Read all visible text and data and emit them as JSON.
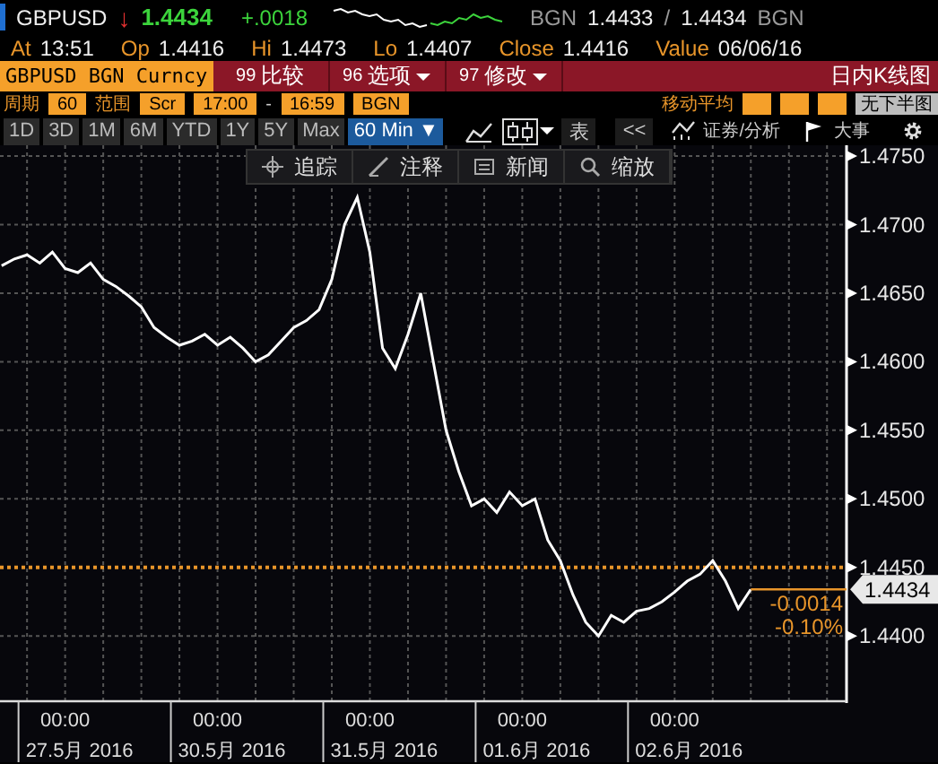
{
  "quote": {
    "ticker": "GBPUSD",
    "arrow": "↓",
    "last": "1.4434",
    "change": "+.0018",
    "bid_source": "BGN",
    "bid": "1.4433",
    "separator": "/",
    "ask": "1.4434",
    "ask_source": "BGN"
  },
  "stats": [
    {
      "label": "At",
      "value": "13:51"
    },
    {
      "label": "Op",
      "value": "1.4416"
    },
    {
      "label": "Hi",
      "value": "1.4473"
    },
    {
      "label": "Lo",
      "value": "1.4407"
    },
    {
      "label": "Close",
      "value": "1.4416"
    },
    {
      "label": "Value",
      "value": "06/06/16"
    }
  ],
  "command_bar": {
    "security": "GBPUSD BGN Curncy",
    "actions": [
      {
        "code": "99",
        "label": "比较",
        "dropdown": false
      },
      {
        "code": "96",
        "label": "选项",
        "dropdown": true
      },
      {
        "code": "97",
        "label": "修改",
        "dropdown": true
      }
    ],
    "view_title": "日内K线图"
  },
  "settings": {
    "period_label": "周期",
    "period": "60",
    "range_label": "范围",
    "range_fields": [
      {
        "kind": "field",
        "text": "Scr"
      },
      {
        "kind": "field",
        "text": "17:00"
      },
      {
        "kind": "text",
        "text": "-"
      },
      {
        "kind": "field",
        "text": "16:59"
      },
      {
        "kind": "field",
        "text": "BGN"
      }
    ],
    "moving_average_label": "移动平均",
    "lower_chart": "无下半图"
  },
  "toolbar": {
    "ranges": [
      {
        "label": "1D",
        "selected": false
      },
      {
        "label": "3D",
        "selected": false
      },
      {
        "label": "1M",
        "selected": false
      },
      {
        "label": "6M",
        "selected": false
      },
      {
        "label": "YTD",
        "selected": false
      },
      {
        "label": "1Y",
        "selected": false
      },
      {
        "label": "5Y",
        "selected": false
      },
      {
        "label": "Max",
        "selected": false
      },
      {
        "label": "60 Min ▼",
        "selected": true
      }
    ],
    "chart_types": [
      {
        "kind": "line",
        "selected": false
      },
      {
        "kind": "candle",
        "selected": true
      }
    ],
    "table_button": "表",
    "back_button": "<<",
    "analysis": "证券/分析",
    "events": "大事"
  },
  "chart_tools": [
    {
      "kind": "crosshair",
      "label": "追踪"
    },
    {
      "kind": "pencil",
      "label": "注释"
    },
    {
      "kind": "news",
      "label": "新闻"
    },
    {
      "kind": "search",
      "label": "缩放"
    }
  ],
  "chart": {
    "last_price_tag": "1.4434",
    "change": "-0.0014",
    "change_pct": "-0.10%",
    "dates": [
      "27.5月 2016",
      "30.5月 2016",
      "31.5月 2016",
      "01.6月 2016",
      "02.6月 2016"
    ],
    "chart_data": {
      "type": "line",
      "categories": [
        null,
        null,
        null,
        null,
        null,
        "00:00",
        null,
        null,
        null,
        null,
        null,
        null,
        null,
        null,
        null,
        null,
        null,
        "00:00",
        null,
        null,
        null,
        null,
        null,
        null,
        null,
        null,
        null,
        null,
        null,
        "00:00",
        null,
        null,
        null,
        null,
        null,
        null,
        null,
        null,
        null,
        null,
        null,
        "00:00",
        null,
        null,
        null,
        null,
        null,
        null,
        null,
        null,
        null,
        null,
        null,
        "00:00",
        null,
        null,
        null,
        null,
        null,
        null
      ],
      "series": [
        {
          "color": "#ffffff",
          "values": [
            1.467,
            1.4675,
            1.4678,
            1.4672,
            1.468,
            1.4668,
            1.4665,
            1.4672,
            1.466,
            1.4655,
            1.4648,
            1.464,
            1.4625,
            1.4618,
            1.4612,
            1.4615,
            1.462,
            1.4612,
            1.4618,
            1.461,
            1.46,
            1.4605,
            1.4615,
            1.4625,
            1.463,
            1.4638,
            1.466,
            1.47,
            1.472,
            1.468,
            1.461,
            1.4595,
            1.462,
            1.465,
            1.46,
            1.455,
            1.452,
            1.4495,
            1.45,
            1.449,
            1.4505,
            1.4495,
            1.45,
            1.447,
            1.4455,
            1.443,
            1.441,
            1.44,
            1.4415,
            1.441,
            1.4418,
            1.442,
            1.4425,
            1.4432,
            1.444,
            1.4445,
            1.4455,
            1.444,
            1.442,
            1.4434
          ]
        }
      ],
      "ylim": [
        1.43524,
        1.47579
      ],
      "grid": true,
      "yticks": [
        {
          "value": 1.475,
          "label": "1.4750"
        },
        {
          "value": 1.47,
          "label": "1.4700"
        },
        {
          "value": 1.465,
          "label": "1.4650"
        },
        {
          "value": 1.46,
          "label": "1.4600"
        },
        {
          "value": 1.455,
          "label": "1.4550"
        },
        {
          "value": 1.45,
          "label": "1.4500"
        },
        {
          "value": 1.445,
          "label": "1.4450"
        },
        {
          "value": 1.44,
          "label": "1.4400"
        }
      ],
      "ref_lines": [
        {
          "axis": "y",
          "value": 1.445
        }
      ]
    }
  }
}
